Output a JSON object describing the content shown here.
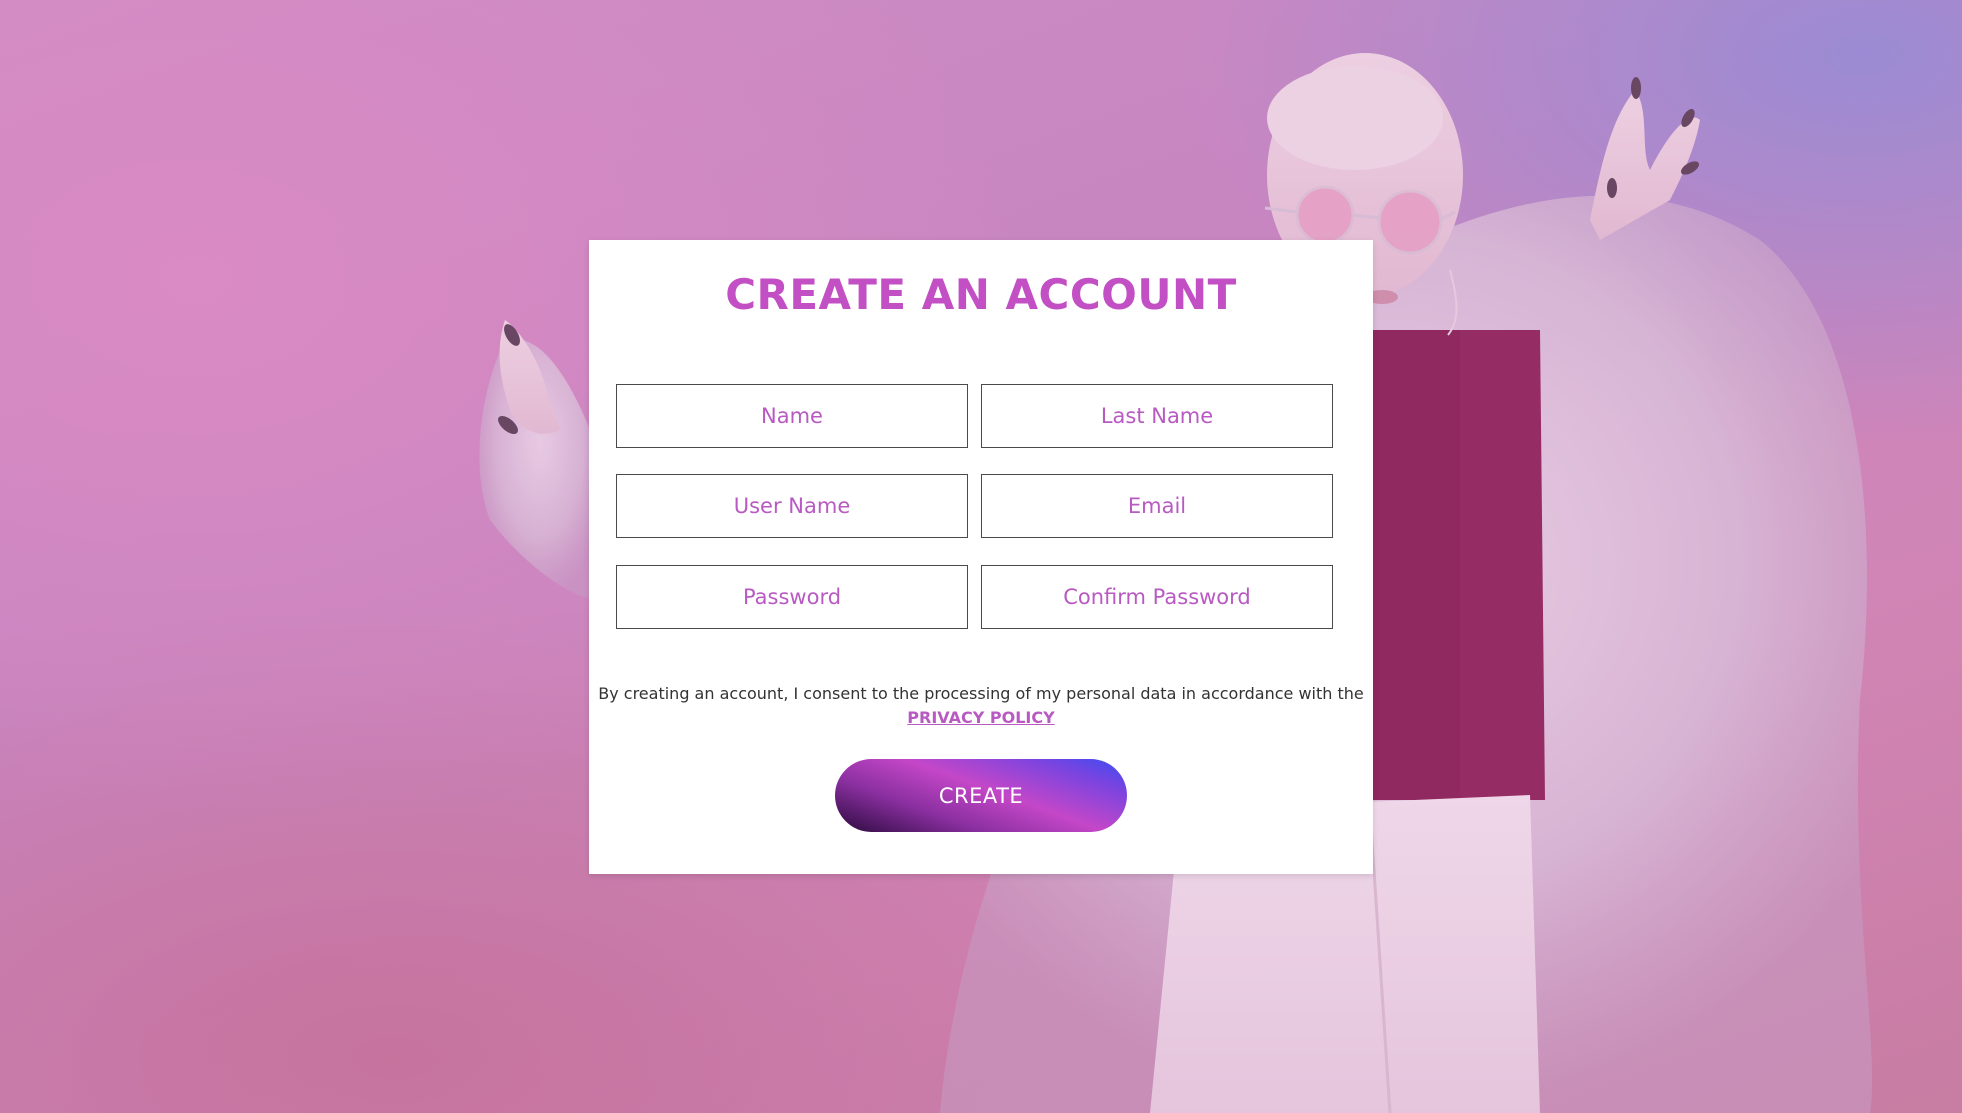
{
  "form": {
    "title": "CREATE AN ACCOUNT",
    "fields": {
      "name": {
        "placeholder": "Name",
        "value": ""
      },
      "last_name": {
        "placeholder": "Last Name",
        "value": ""
      },
      "user_name": {
        "placeholder": "User Name",
        "value": ""
      },
      "email": {
        "placeholder": "Email",
        "value": ""
      },
      "password": {
        "placeholder": "Password",
        "value": ""
      },
      "confirm_password": {
        "placeholder": "Confirm Password",
        "value": ""
      }
    },
    "consent_text": "By creating an account, I consent to the processing of my personal data in accordance with the",
    "privacy_link_label": "PRIVACY POLICY",
    "submit_label": "CREATE"
  },
  "colors": {
    "accent": "#c24fc4",
    "placeholder": "#b85ac2",
    "button_gradient": [
      "#3a4cf2",
      "#c447c8",
      "#2a0a3c"
    ]
  }
}
